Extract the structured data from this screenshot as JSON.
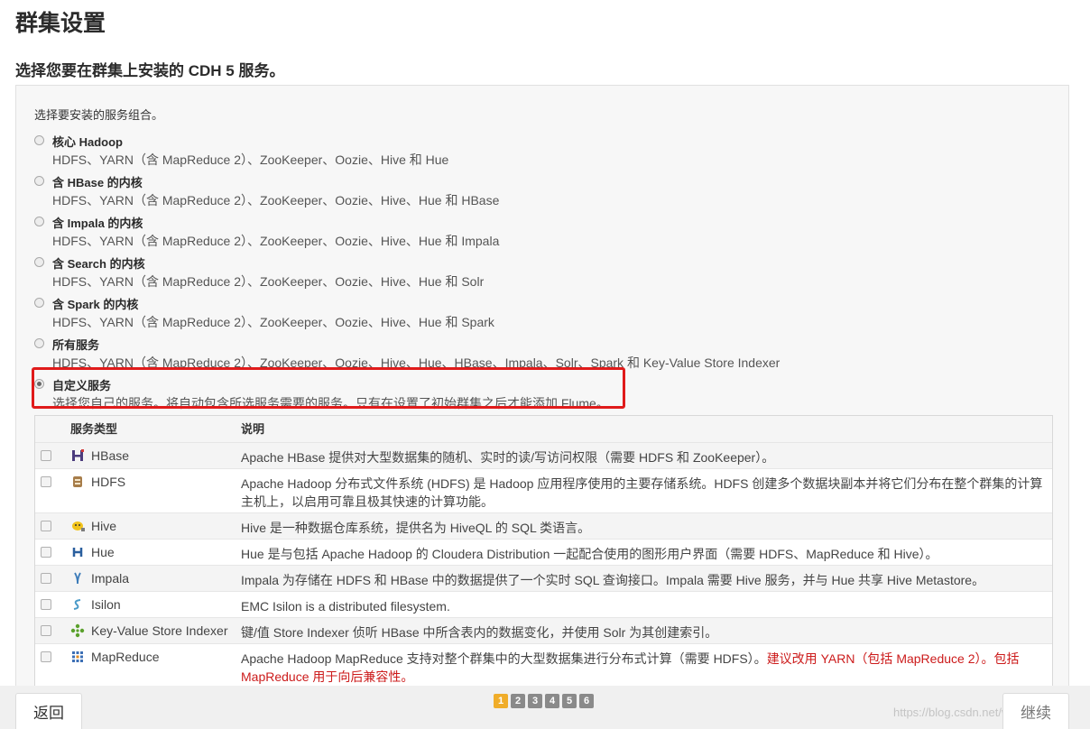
{
  "page": {
    "title": "群集设置",
    "subtitle": "选择您要在群集上安装的 CDH 5 服务。"
  },
  "selection": {
    "prompt": "选择要安装的服务组合。",
    "options": [
      {
        "title": "核心 Hadoop",
        "desc": "HDFS、YARN（含 MapReduce 2）、ZooKeeper、Oozie、Hive 和 Hue",
        "checked": false
      },
      {
        "title": "含 HBase 的内核",
        "desc": "HDFS、YARN（含 MapReduce 2）、ZooKeeper、Oozie、Hive、Hue 和 HBase",
        "checked": false
      },
      {
        "title": "含 Impala 的内核",
        "desc": "HDFS、YARN（含 MapReduce 2）、ZooKeeper、Oozie、Hive、Hue 和 Impala",
        "checked": false
      },
      {
        "title": "含 Search 的内核",
        "desc": "HDFS、YARN（含 MapReduce 2）、ZooKeeper、Oozie、Hive、Hue 和 Solr",
        "checked": false
      },
      {
        "title": "含 Spark 的内核",
        "desc": "HDFS、YARN（含 MapReduce 2）、ZooKeeper、Oozie、Hive、Hue 和 Spark",
        "checked": false
      },
      {
        "title": "所有服务",
        "desc": "HDFS、YARN（含 MapReduce 2）、ZooKeeper、Oozie、Hive、Hue、HBase、Impala、Solr、Spark 和 Key-Value Store Indexer",
        "checked": false
      },
      {
        "title": "自定义服务",
        "desc": "选择您自己的服务。将自动包含所选服务需要的服务。只有在设置了初始群集之后才能添加 Flume。",
        "checked": true
      }
    ]
  },
  "services_table": {
    "headers": {
      "type": "服务类型",
      "desc": "说明"
    },
    "rows": [
      {
        "name": "HBase",
        "icon": "hbase-icon",
        "desc": "Apache HBase 提供对大型数据集的随机、实时的读/写访问权限（需要 HDFS 和 ZooKeeper）。"
      },
      {
        "name": "HDFS",
        "icon": "hdfs-icon",
        "desc": "Apache Hadoop 分布式文件系统 (HDFS) 是 Hadoop 应用程序使用的主要存储系统。HDFS 创建多个数据块副本并将它们分布在整个群集的计算主机上，以启用可靠且极其快速的计算功能。"
      },
      {
        "name": "Hive",
        "icon": "hive-icon",
        "desc": "Hive 是一种数据仓库系统，提供名为 HiveQL 的 SQL 类语言。"
      },
      {
        "name": "Hue",
        "icon": "hue-icon",
        "desc": "Hue 是与包括 Apache Hadoop 的 Cloudera Distribution 一起配合使用的图形用户界面（需要 HDFS、MapReduce 和 Hive）。"
      },
      {
        "name": "Impala",
        "icon": "impala-icon",
        "desc": "Impala 为存储在 HDFS 和 HBase 中的数据提供了一个实时 SQL 查询接口。Impala 需要 Hive 服务，并与 Hue 共享 Hive Metastore。"
      },
      {
        "name": "Isilon",
        "icon": "isilon-icon",
        "desc": "EMC Isilon is a distributed filesystem."
      },
      {
        "name": "Key-Value Store Indexer",
        "icon": "kv-indexer-icon",
        "desc": "键/值 Store Indexer 侦听 HBase 中所含表内的数据变化，并使用 Solr 为其创建索引。"
      },
      {
        "name": "MapReduce",
        "icon": "mapreduce-icon",
        "desc": "Apache Hadoop MapReduce 支持对整个群集中的大型数据集进行分布式计算（需要 HDFS）。",
        "warning": "建议改用 YARN（包括 MapReduce 2）。包括 MapReduce 用于向后兼容性。"
      }
    ]
  },
  "footer": {
    "back_label": "返回",
    "next_label": "继续",
    "pages": [
      "1",
      "2",
      "3",
      "4",
      "5",
      "6"
    ],
    "active_page": 0,
    "watermark": "https://blog.csdn.net/weixin_nnb"
  }
}
